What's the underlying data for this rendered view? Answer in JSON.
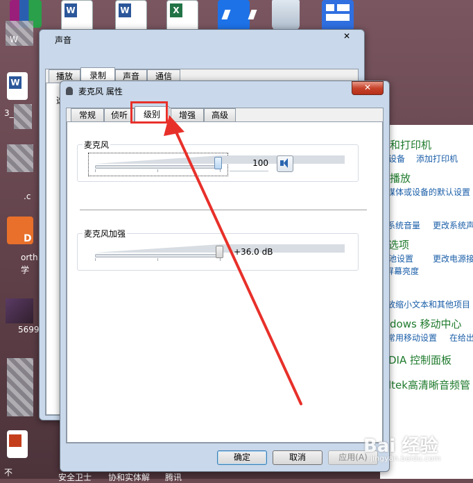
{
  "desktop": {
    "labels": {
      "w_label": "W",
      "file_3": "3_",
      "ext_c": ".c",
      "item_D": "D",
      "orth": "orth",
      "xue": "学",
      "num": "5699",
      "bu": "不"
    },
    "taskbar_partial": [
      "安全卫士",
      "协和实体解",
      "腾讯"
    ]
  },
  "control_panel": {
    "headings": [
      "和打印机",
      "播放",
      "选项",
      "dows 移动中心",
      "DIA 控制面板",
      "ltek高清晰音频管"
    ],
    "links": [
      "设备",
      "添加打印机",
      "媒体或设备的默认设置",
      "系统音量",
      "更改系统声",
      "池设置",
      "更改电源接",
      "屏幕亮度",
      "放缩小文本和其他项目",
      "常用移动设置",
      "在给出"
    ]
  },
  "sound_dialog": {
    "title": "声音",
    "tabs": [
      "播放",
      "录制",
      "声音",
      "通信"
    ],
    "active_tab": "录制",
    "partial_text": "选"
  },
  "mic_dialog": {
    "title": "麦克风 属性",
    "tabs": [
      "常规",
      "侦听",
      "级别",
      "增强",
      "高级"
    ],
    "active_tab": "级别",
    "microphone": {
      "label": "麦克风",
      "value_text": "100",
      "level_fraction": 1.0
    },
    "boost": {
      "label": "麦克风加强",
      "value_text": "+36.0 dB",
      "level_fraction": 1.0
    },
    "buttons": {
      "ok": "确定",
      "cancel": "取消",
      "apply": "应用(A)"
    }
  },
  "watermark": "Bai 经验",
  "watermark_url": "jingyan.baidu.com",
  "colors": {
    "highlight": "#e8302a",
    "link": "#1a5ea8",
    "heading": "#1e7a2c"
  }
}
